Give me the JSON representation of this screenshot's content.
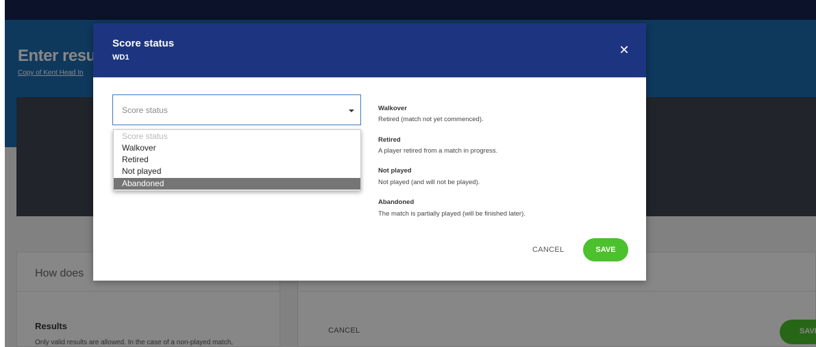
{
  "background": {
    "page_title": "Enter results",
    "page_subtitle": "Copy of Kent Head In",
    "how_does": "How does",
    "results_heading": "Results",
    "results_text": "Only valid results are allowed. In the case of a non-played match,",
    "cancel_label": "CANCEL",
    "save_label": "SAVE"
  },
  "modal": {
    "title": "Score status",
    "subtitle": "WD1",
    "close_icon": "close-icon",
    "select": {
      "value": "Score status",
      "options": [
        "Score status",
        "Walkover",
        "Retired",
        "Not played",
        "Abandoned"
      ],
      "highlighted": "Abandoned"
    },
    "info": [
      {
        "title": "Walkover",
        "desc": "Retired (match not yet commenced)."
      },
      {
        "title": "Retired",
        "desc": "A player retired from a match in progress."
      },
      {
        "title": "Not played",
        "desc": "Not played (and will not be played)."
      },
      {
        "title": "Abandoned",
        "desc": "The match is partially played (will be finished later)."
      }
    ],
    "cancel_label": "CANCEL",
    "save_label": "SAVE"
  },
  "colors": {
    "topbar": "#16224f",
    "header": "#1d6ab0",
    "modal_header": "#1d3580",
    "save_button": "#4cc02d",
    "selected_option": "#757575"
  }
}
